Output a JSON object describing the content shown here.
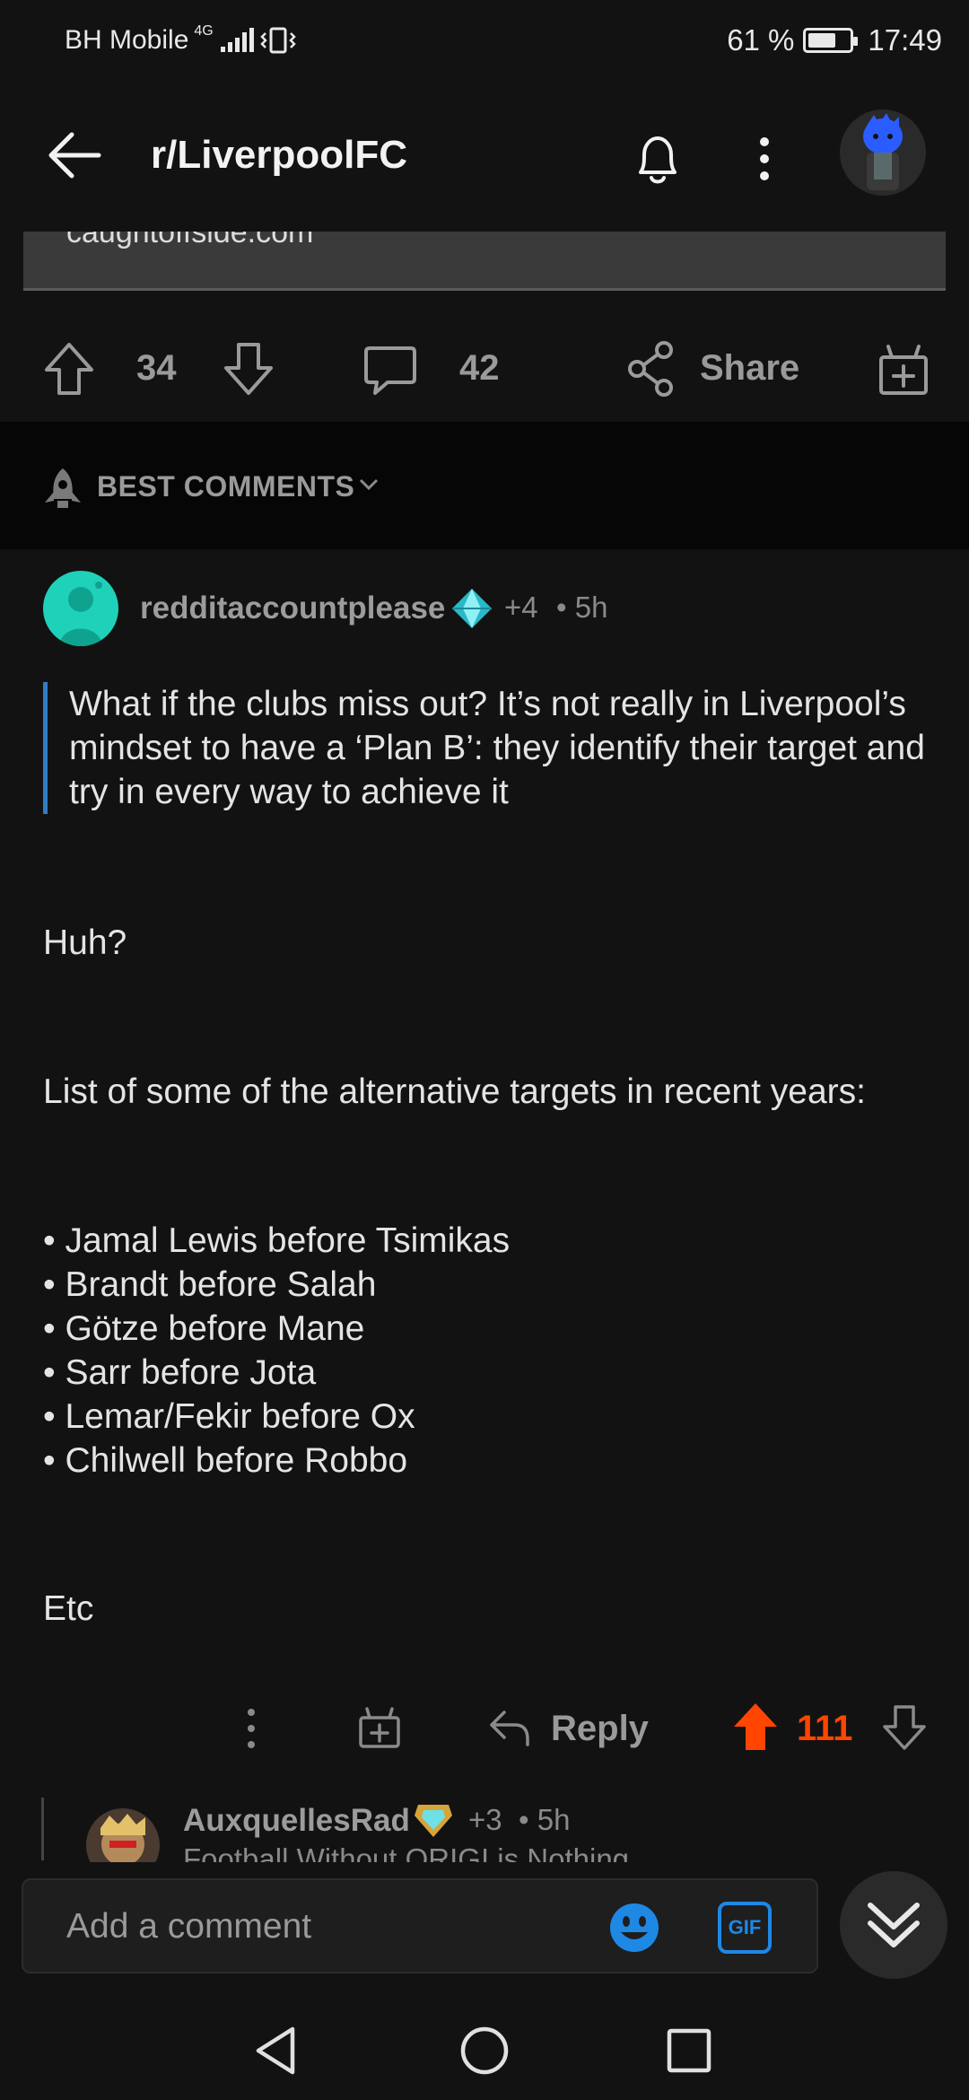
{
  "status_bar": {
    "carrier": "BH Mobile",
    "network": "4G",
    "battery": "61 %",
    "time": "17:49"
  },
  "header": {
    "title": "r/LiverpoolFC"
  },
  "preview": {
    "url": "caughtoffside.com"
  },
  "post_actions": {
    "upvotes": "34",
    "comments": "42",
    "share_label": "Share"
  },
  "sort": {
    "label": "BEST COMMENTS"
  },
  "comment": {
    "author": "redditaccountplease",
    "award_count": "+4",
    "age": "• 5h",
    "quote": "What if the clubs miss out? It’s not really in Liverpool’s mindset to have a ‘Plan B’: they identify their target and try in every way to achieve it",
    "p1": "Huh?",
    "p2": "List of some of the alternative targets in recent years:",
    "bullets": [
      "• Jamal Lewis before Tsimikas",
      "• Brandt before Salah",
      "• Götze before Mane",
      "• Sarr before Jota",
      "• Lemar/Fekir before Ox",
      "• Chilwell before Robbo"
    ],
    "p3": "Etc",
    "reply_label": "Reply",
    "score": "111"
  },
  "reply_preview": {
    "author": "AuxquellesRad",
    "award_count": "+3",
    "age": "• 5h",
    "flair": "Football Without ORIGI is Nothing"
  },
  "composer": {
    "placeholder": "Add a comment",
    "gif_label": "GIF"
  },
  "colors": {
    "accent": "#ff4500",
    "link": "#2f7ec3",
    "background": "#121212"
  }
}
